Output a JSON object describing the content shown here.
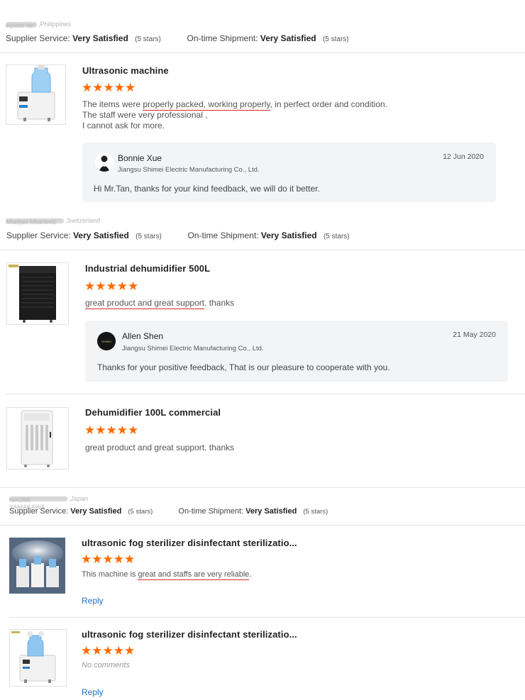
{
  "reviews": [
    {
      "buyer": {
        "blurred_name": "elpidio tan",
        "country": "Philippines"
      },
      "supplier_label": "Supplier Service:",
      "supplier_value": "Very Satisfied",
      "supplier_stars": "(5 stars)",
      "shipment_label": "On-time Shipment:",
      "shipment_value": "Very Satisfied",
      "shipment_stars": "(5 stars)",
      "products": [
        {
          "title": "Ultrasonic machine",
          "stars": "★★★★★",
          "text": {
            "p1": "The items were ",
            "u1": "properly packed, working properly",
            "p2": ", in perfect order and condition.",
            "line2": "The staff were very professional ,",
            "line3": "I cannot ask for more."
          },
          "reply": {
            "name": "Bonnie Xue",
            "company": "Jiangsu Shimei Electric Manufacturing Co., Ltd.",
            "date": "12 Jun 2020",
            "text": "Hi Mr.Tan, thanks for your kind feedback, we will do it better."
          }
        }
      ]
    },
    {
      "buyer": {
        "blurred_name": "Mladjan Milanovic",
        "country": "Switzerland"
      },
      "supplier_label": "Supplier Service:",
      "supplier_value": "Very Satisfied",
      "supplier_stars": "(5 stars)",
      "shipment_label": "On-time Shipment:",
      "shipment_value": "Very Satisfied",
      "shipment_stars": "(5 stars)",
      "products": [
        {
          "title": "Industrial dehumidifier 500L",
          "stars": "★★★★★",
          "text": {
            "u1": "great product and great support",
            "p2": ". thanks"
          },
          "reply": {
            "name": "Allen Shen",
            "company": "Jiangsu Shimei Electric Manufacturing Co., Ltd.",
            "date": "21 May 2020",
            "text": "Thanks for your positive feedback, That is our pleasure to cooperate with you."
          }
        },
        {
          "title": "Dehumidifier 100L commercial",
          "stars": "★★★★★",
          "text": {
            "plain": "great product and great support. thanks"
          }
        }
      ]
    },
    {
      "buyer": {
        "blurred_name": "NAOMI YAMAKAWA",
        "country": "Japan"
      },
      "supplier_label": "Supplier Service:",
      "supplier_value": "Very Satisfied",
      "supplier_stars": "(5 stars)",
      "shipment_label": "On-time Shipment:",
      "shipment_value": "Very Satisfied",
      "shipment_stars": "(5 stars)",
      "products": [
        {
          "title": "ultrasonic fog sterilizer disinfectant sterilizatio...",
          "stars": "★★★★★",
          "text": {
            "p1": "This machine is ",
            "u1": "great and staffs are very reliable",
            "p2": "."
          },
          "reply_link": "Reply"
        },
        {
          "title": "ultrasonic fog sterilizer disinfectant sterilizatio...",
          "stars": "★★★★★",
          "text": {
            "nocomment": "No comments"
          },
          "reply_link": "Reply"
        }
      ]
    }
  ],
  "colors": {
    "star": "#ff6a00",
    "underline": "#d62a2a",
    "link": "#1a73c8",
    "reply_bg": "#f3f4f6"
  }
}
